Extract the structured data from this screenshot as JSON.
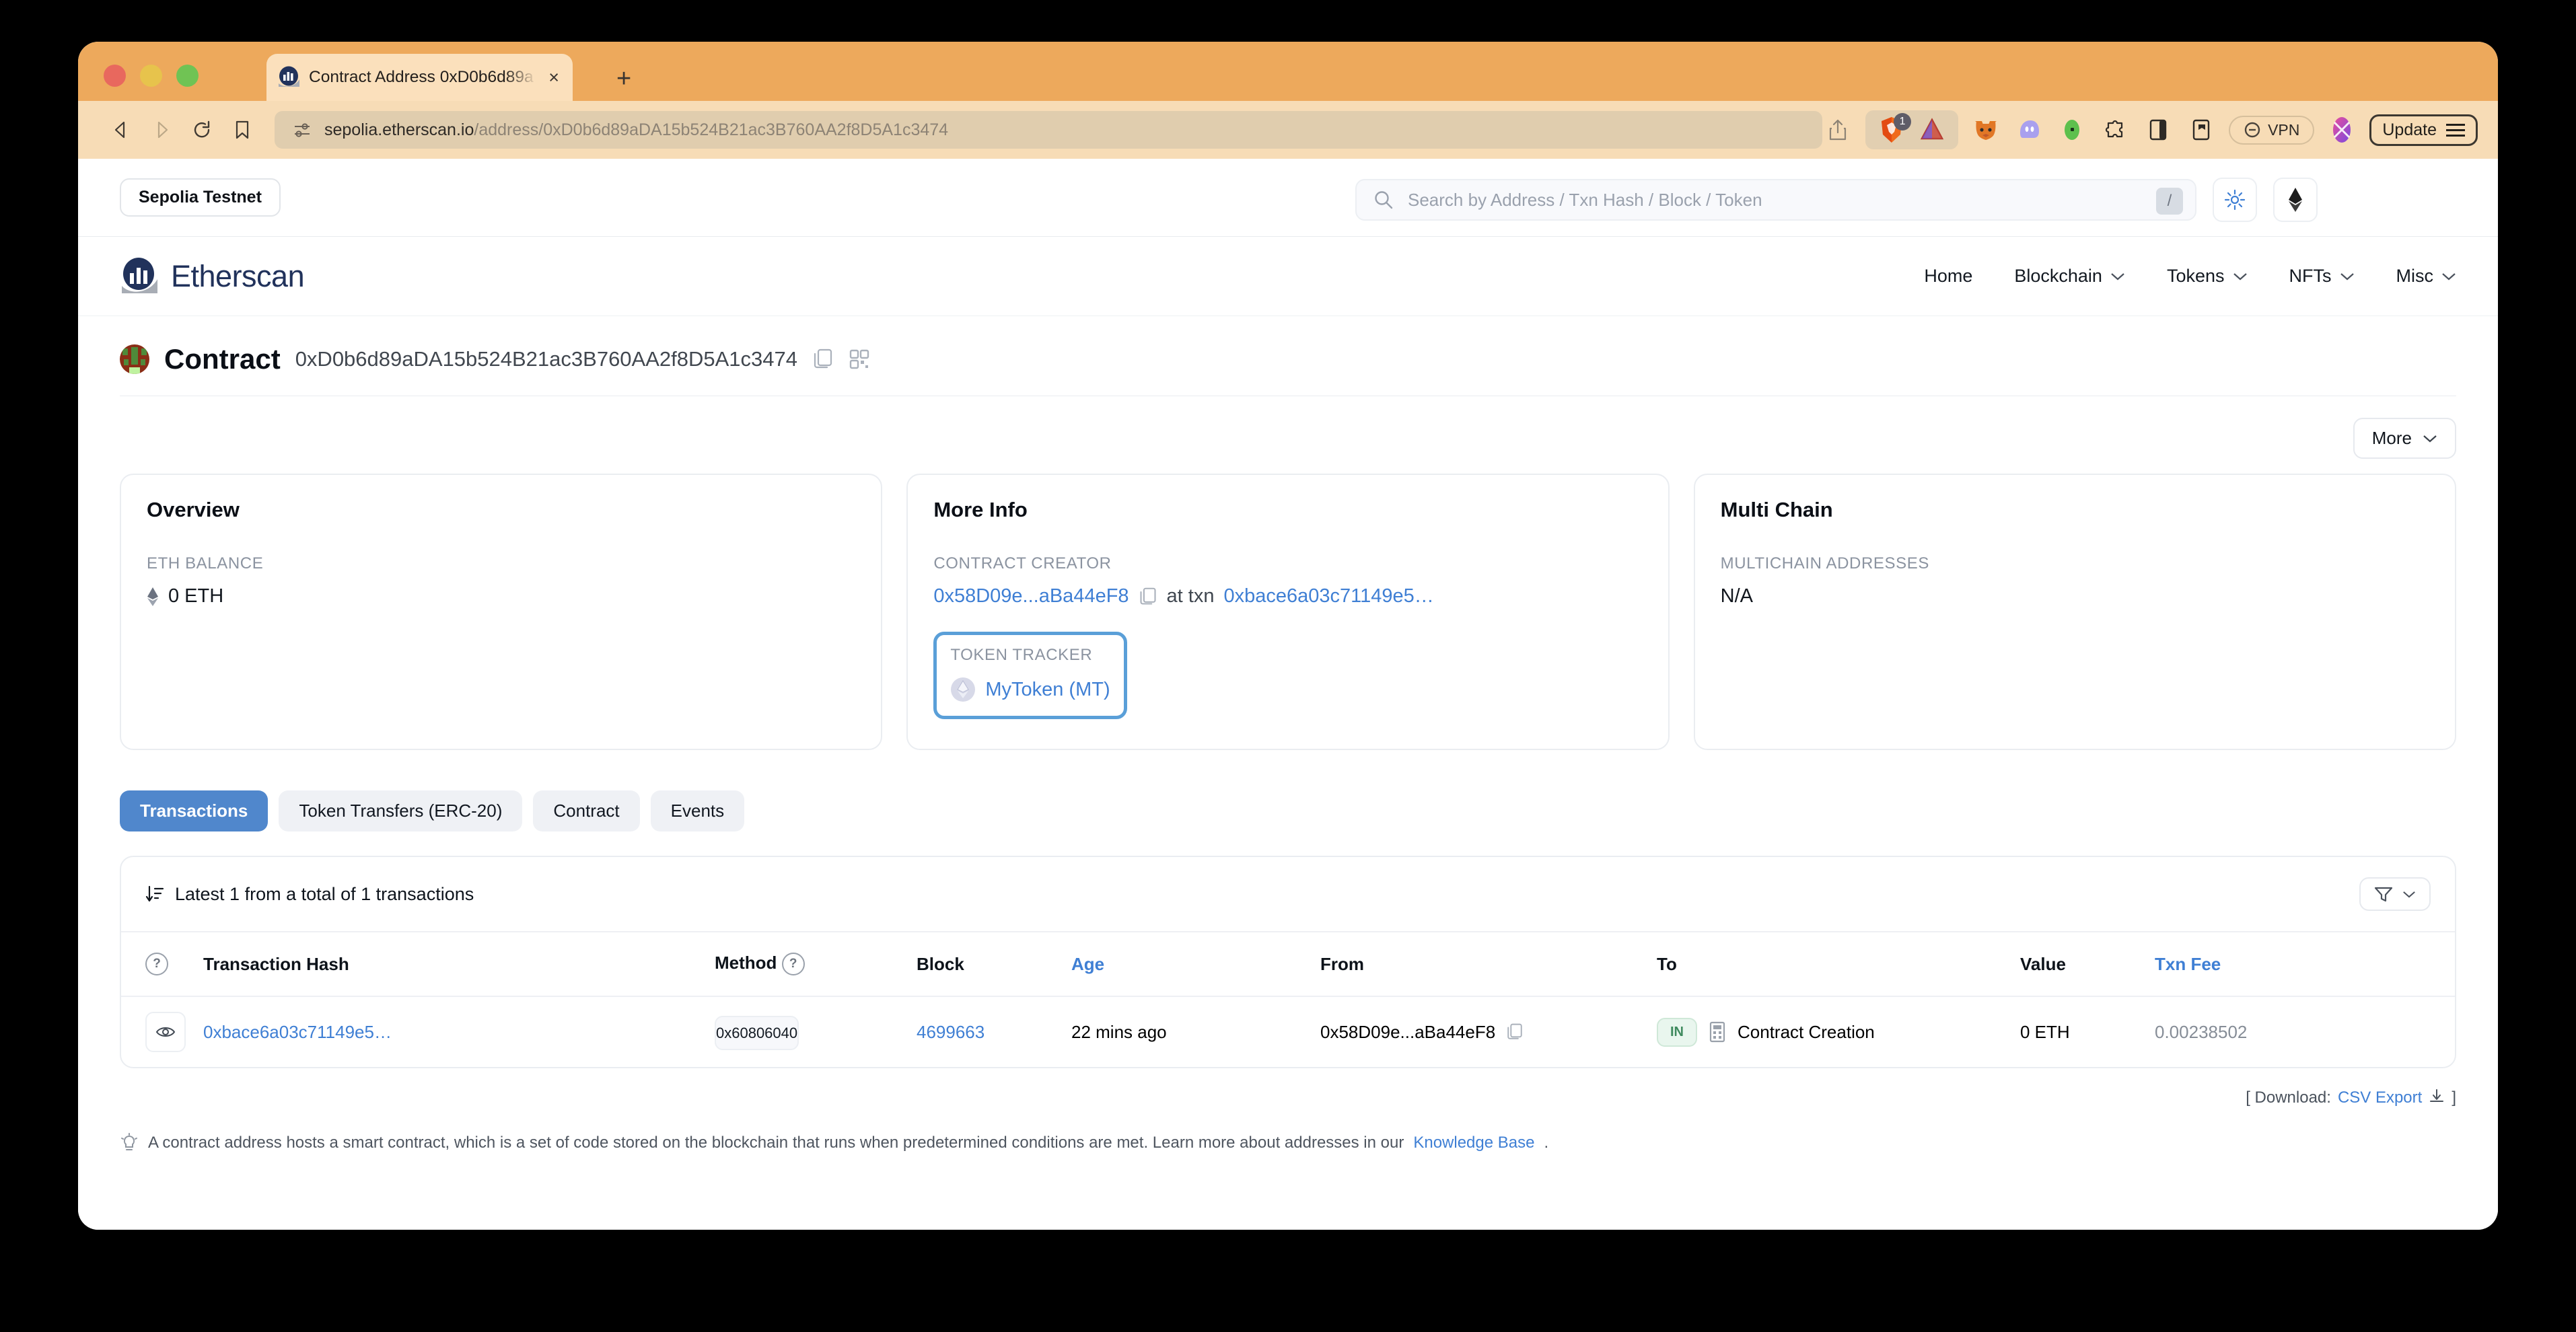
{
  "browser": {
    "tab": {
      "title": "Contract Address 0xD0b6d89a",
      "close_label": "×",
      "favicon": "etherscan-favicon"
    },
    "newtab_label": "+",
    "url": {
      "scheme_host": "sepolia.etherscan.io",
      "path": "/address/0xD0b6d89aDA15b524B21ac3B760AA2f8D5A1c3474"
    },
    "toolbar": {
      "back": "◁",
      "forward": "▷",
      "reload": "↻",
      "bookmark": "bookmark-icon",
      "share": "share-icon",
      "brave_shield_badge": "1",
      "vpn_label": "VPN",
      "update_label": "Update"
    }
  },
  "site": {
    "network_badge": "Sepolia Testnet",
    "search": {
      "placeholder": "Search by Address / Txn Hash / Block / Token",
      "shortcut": "/"
    },
    "brand": "Etherscan",
    "nav": [
      {
        "label": "Home",
        "has_menu": false
      },
      {
        "label": "Blockchain",
        "has_menu": true
      },
      {
        "label": "Tokens",
        "has_menu": true
      },
      {
        "label": "NFTs",
        "has_menu": true
      },
      {
        "label": "Misc",
        "has_menu": true
      }
    ],
    "theme_toggle": "sun-icon",
    "eth_icon": "ethereum-icon"
  },
  "header": {
    "type_label": "Contract",
    "address": "0xD0b6d89aDA15b524B21ac3B760AA2f8D5A1c3474",
    "copy_icon": "copy-icon",
    "qr_icon": "qr-code-icon",
    "more_button": "More"
  },
  "overview": {
    "title": "Overview",
    "eth_balance_label": "ETH BALANCE",
    "eth_balance_value": "0 ETH"
  },
  "more_info": {
    "title": "More Info",
    "creator_label": "CONTRACT CREATOR",
    "creator_address": "0x58D09e...aBa44eF8",
    "at_txn_text": "at txn",
    "creation_txn": "0xbace6a03c71149e5…",
    "token_tracker_label": "TOKEN TRACKER",
    "token_name": "MyToken (MT)",
    "highlight_color": "#5a9fd8"
  },
  "multi_chain": {
    "title": "Multi Chain",
    "addresses_label": "MULTICHAIN ADDRESSES",
    "addresses_value": "N/A"
  },
  "tabs": [
    {
      "label": "Transactions",
      "active": true
    },
    {
      "label": "Token Transfers (ERC-20)",
      "active": false
    },
    {
      "label": "Contract",
      "active": false
    },
    {
      "label": "Events",
      "active": false
    }
  ],
  "transactions": {
    "summary": "Latest 1 from a total of 1 transactions",
    "sort_icon": "sort-descending-icon",
    "filter_icon": "funnel-icon",
    "columns": {
      "eye": "",
      "hash": "Transaction Hash",
      "method": "Method",
      "block": "Block",
      "age": "Age",
      "from": "From",
      "to": "To",
      "value": "Value",
      "fee": "Txn Fee"
    },
    "rows": [
      {
        "hash": "0xbace6a03c71149e5…",
        "method": "0x60806040",
        "block": "4699663",
        "age": "22 mins ago",
        "from": "0x58D09e...aBa44eF8",
        "direction": "IN",
        "to": "Contract Creation",
        "value": "0 ETH",
        "fee": "0.00238502"
      }
    ],
    "download_prefix": "[ Download:",
    "download_link": "CSV Export",
    "download_suffix": "]"
  },
  "footnote": {
    "text": "A contract address hosts a smart contract, which is a set of code stored on the blockchain that runs when predetermined conditions are met. Learn more about addresses in our",
    "link": "Knowledge Base",
    "period": "."
  }
}
